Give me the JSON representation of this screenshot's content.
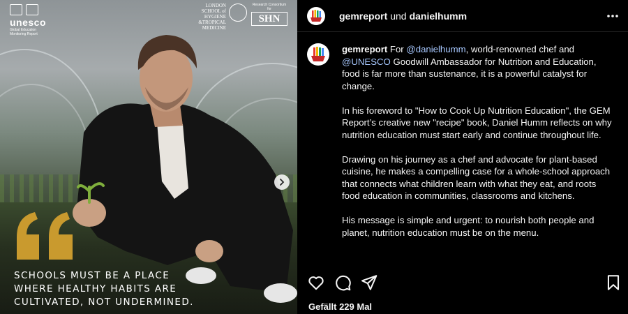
{
  "media": {
    "unesco": {
      "wordmark": "unesco",
      "subtitle": "Global Education Monitoring Report"
    },
    "lshtm": {
      "lines": [
        "LONDON",
        "SCHOOL of",
        "HYGIENE",
        "&TROPICAL",
        "MEDICINE"
      ]
    },
    "shn": {
      "top": "Research Consortium for",
      "mark": "SHN"
    },
    "quote": {
      "line1": "SCHOOLS MUST BE A PLACE",
      "line2": "WHERE HEALTHY HABITS ARE",
      "line3": "CULTIVATED, NOT UNDERMINED."
    },
    "quote_color": "#c99a2e",
    "next_icon": "chevron-right-icon"
  },
  "header": {
    "user1": "gemreport",
    "joiner": "und",
    "user2": "danielhumm",
    "more_icon": "more-horizontal-icon"
  },
  "caption": {
    "author": "gemreport",
    "p1": {
      "pre": "For",
      "mention1": "@danielhumm",
      "mid": ", world-renowned chef and",
      "mention2": "@UNESCO",
      "post": "Goodwill Ambassador for Nutrition and Education, food is far more than sustenance, it is a powerful catalyst for change."
    },
    "p2": "In his foreword to \"How to Cook Up Nutrition Education\", the GEM Report’s creative new \"recipe\" book, Daniel Humm reflects on why nutrition education must start early and continue throughout life.",
    "p3": "Drawing on his journey as a chef and advocate for plant-based cuisine, he makes a compelling case for a whole-school approach that connects what children learn with what they eat, and roots food education in communities, classrooms and kitchens.",
    "p4": "His message is simple and urgent: to nourish both people and planet, nutrition education must be on the menu."
  },
  "actions": {
    "like_icon": "heart-icon",
    "comment_icon": "comment-icon",
    "share_icon": "send-icon",
    "save_icon": "bookmark-icon"
  },
  "likes": "Gefällt 229 Mal",
  "colors": {
    "background": "#000000",
    "text": "#f5f5f5",
    "link": "#a7c8ff",
    "divider": "#262626"
  }
}
